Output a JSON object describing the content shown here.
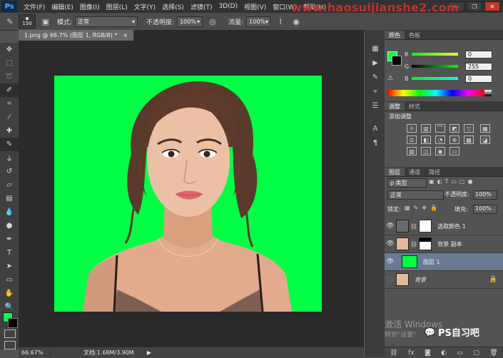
{
  "app": {
    "logo": "Ps"
  },
  "menu": [
    "文件(F)",
    "编辑(E)",
    "图像(I)",
    "图层(L)",
    "文字(Y)",
    "选择(S)",
    "滤镜(T)",
    "3D(D)",
    "视图(V)",
    "窗口(W)",
    "帮助(H)"
  ],
  "watermark": "www.haosuijianshe2.com",
  "options": {
    "brush_size": "150",
    "mode_label": "模式:",
    "mode_value": "正常",
    "opacity_label": "不透明度:",
    "opacity_value": "100%",
    "flow_label": "流量:",
    "flow_value": "100%"
  },
  "document": {
    "tab_title": "1.png @ 66.7% (图层 1, RGB/8) *",
    "close": "×"
  },
  "status": {
    "zoom": "66.67%",
    "doc_info": "文档:1.68M/3.90M",
    "arrow": "▶"
  },
  "color_panel": {
    "tabs": [
      "颜色",
      "色板"
    ],
    "r_label": "R",
    "r_value": "0",
    "g_label": "G",
    "g_value": "255",
    "b_label": "B",
    "b_value": "0"
  },
  "adjust_panel": {
    "tabs": [
      "调整",
      "样式"
    ],
    "title": "添加调整"
  },
  "layers_panel": {
    "tabs": [
      "图层",
      "通道",
      "路径"
    ],
    "filter_label": "ρ 类型",
    "blend_mode": "正常",
    "opacity_label": "不透明度:",
    "opacity_value": "100%",
    "lock_label": "锁定:",
    "fill_label": "填充:",
    "fill_value": "100%",
    "layers": [
      {
        "name": "选取颜色 1"
      },
      {
        "name": "背景 副本"
      },
      {
        "name": "图层 1"
      },
      {
        "name": "背景"
      }
    ]
  },
  "overlay": {
    "activate_windows": "激活 Windows",
    "activate_sub": "转到\"设置\"",
    "wechat_brand": "PS自习吧"
  },
  "colors": {
    "foreground": "#00ff45",
    "background": "#000000",
    "canvas": "#00ff45",
    "selected_layer": "#6a7a95"
  }
}
